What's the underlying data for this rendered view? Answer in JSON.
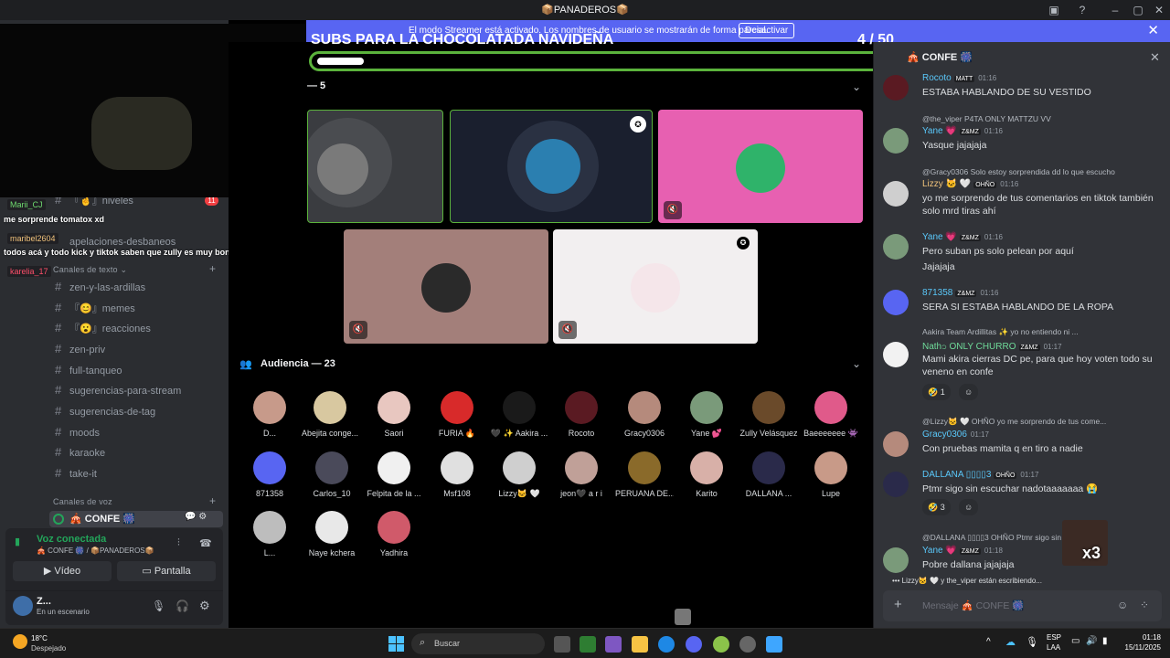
{
  "titlebar": {
    "title": "📦PANADEROS📦"
  },
  "banner": {
    "text": "El modo Streamer está activado. Los nombres de usuario se mostrarán de forma parcial.",
    "button": "Desactivar"
  },
  "sidebar": {
    "channels_top": [
      {
        "name": "『🤞』niveles",
        "badge": "11"
      },
      {
        "name": "apelaciones-desbaneos"
      }
    ],
    "category_text": "Canales de texto",
    "channels": [
      "zen-y-las-ardillas",
      "『😊』memes",
      "『😮』reacciones",
      "zen-priv",
      "full-tanqueo",
      "sugerencias-para-stream",
      "sugerencias-de-tag",
      "moods",
      "karaoke",
      "take-it"
    ],
    "category_voice": "Canales de voz",
    "voice_channel": "🎪 CONFE 🎆",
    "voice": {
      "status": "Voz conectada",
      "location": "🎪 CONFE 🎆 / 📦PANADEROS📦",
      "video": "Vídeo",
      "screen": "Pantalla"
    },
    "user": {
      "name": "Z...",
      "status": "En un escenario"
    }
  },
  "overlay": {
    "chat": [
      {
        "user": "Marii_CJ",
        "text": "me sorprende tomatox xd"
      },
      {
        "user": "maribel2604",
        "text": "todos acá y todo kick y tiktok saben que zully es muy bonita en todo y natural"
      },
      {
        "user": "karelia_17",
        "text": ""
      }
    ]
  },
  "goal": {
    "title": "SUBS PARA LA CHOCOLATADA NAVIDEÑA",
    "count": "4  / 50",
    "progress": 0.08
  },
  "stage": {
    "speakers_label": "— 5",
    "audience_label": "Audiencia — 23",
    "audience": [
      "D...",
      "Abejita conge...",
      "Saori",
      "FURIA 🔥",
      "🖤 ✨ Aakira ...",
      "Rocoto",
      "Gracy0306",
      "Yane 💕",
      "Zully Velásquez",
      "Baeeeeeee 👾",
      "871358",
      "Carlos_10",
      "Felpita de la ...",
      "Msf108",
      "Lizzy🐱 🤍",
      "jeon🖤 a r i",
      "PERUANA DE...",
      "Karito",
      "DALLANA ...",
      "Lupe",
      "L...",
      "Naye kchera",
      "Yadhira"
    ]
  },
  "chat": {
    "title": "🎪 CONFE 🎆",
    "messages": [
      {
        "name": "Rocoto",
        "tag": "MATT",
        "time": "01:16",
        "text": "ESTABA HABLANDO DE SU VESTIDO"
      },
      {
        "reply": "@the_viper  P4TA  ONLY MATTZU VV",
        "name": "Yane 💗",
        "tag": "Z&MZ",
        "time": "01:16",
        "text": "Yasque jajajaja"
      },
      {
        "reply": "@Gracy0306 Solo estoy sorprendida dd lo que escucho",
        "name": "Lizzy 🐱 🤍",
        "tag": "OHÑO",
        "time": "01:16",
        "text": "yo me sorprendo de tus comentarios en tiktok también solo mrd tiras ahí"
      },
      {
        "name": "Yane 💗",
        "tag": "Z&MZ",
        "time": "01:16",
        "text": "Pero suban ps solo pelean por aquí",
        "text2": "Jajajaja"
      },
      {
        "name": "871358",
        "tag": "Z&MZ",
        "time": "01:16",
        "text": "SERA SI ESTABA HABLANDO DE LA ROPA"
      },
      {
        "reply": "Aakira Team Ardillitas ✨  yo no entiendo ni ...",
        "name": "Nath၁ ONLY CHURRO",
        "tag": "Z&MZ",
        "time": "01:17",
        "text": "Mami akira cierras DC pe, para que hoy voten todo su veneno en confe",
        "reaction": "🤣 1"
      },
      {
        "reply": "@Lizzy🐱 🤍  OHÑO  yo me sorprendo de tus come...",
        "name": "Gracy0306",
        "time": "01:17",
        "text": "Con pruebas mamita q en tiro a nadie"
      },
      {
        "name": "DALLANA ▯▯▯▯3",
        "tag": "OHÑO",
        "time": "01:17",
        "text": "Ptmr sigo sin escuchar nadotaaaaaaa 😭",
        "reaction": "🤣 3"
      },
      {
        "reply": "@DALLANA ▯▯▯▯3  OHÑO  Ptmr sigo sin escuchar na...",
        "name": "Yane 💗",
        "tag": "Z&MZ",
        "time": "01:18",
        "text": "Pobre dallana jajajaja"
      }
    ],
    "typing": "Lizzy🐱 🤍 y the_viper están escribiendo...",
    "placeholder": "Mensaje 🎪 CONFE 🎆",
    "sticker_text": "x3"
  },
  "taskbar": {
    "temp": "18°C",
    "weather": "Despejado",
    "search": "Buscar",
    "lang": "ESP",
    "lang2": "LAA",
    "time": "01:18",
    "date": "15/11/2025"
  }
}
